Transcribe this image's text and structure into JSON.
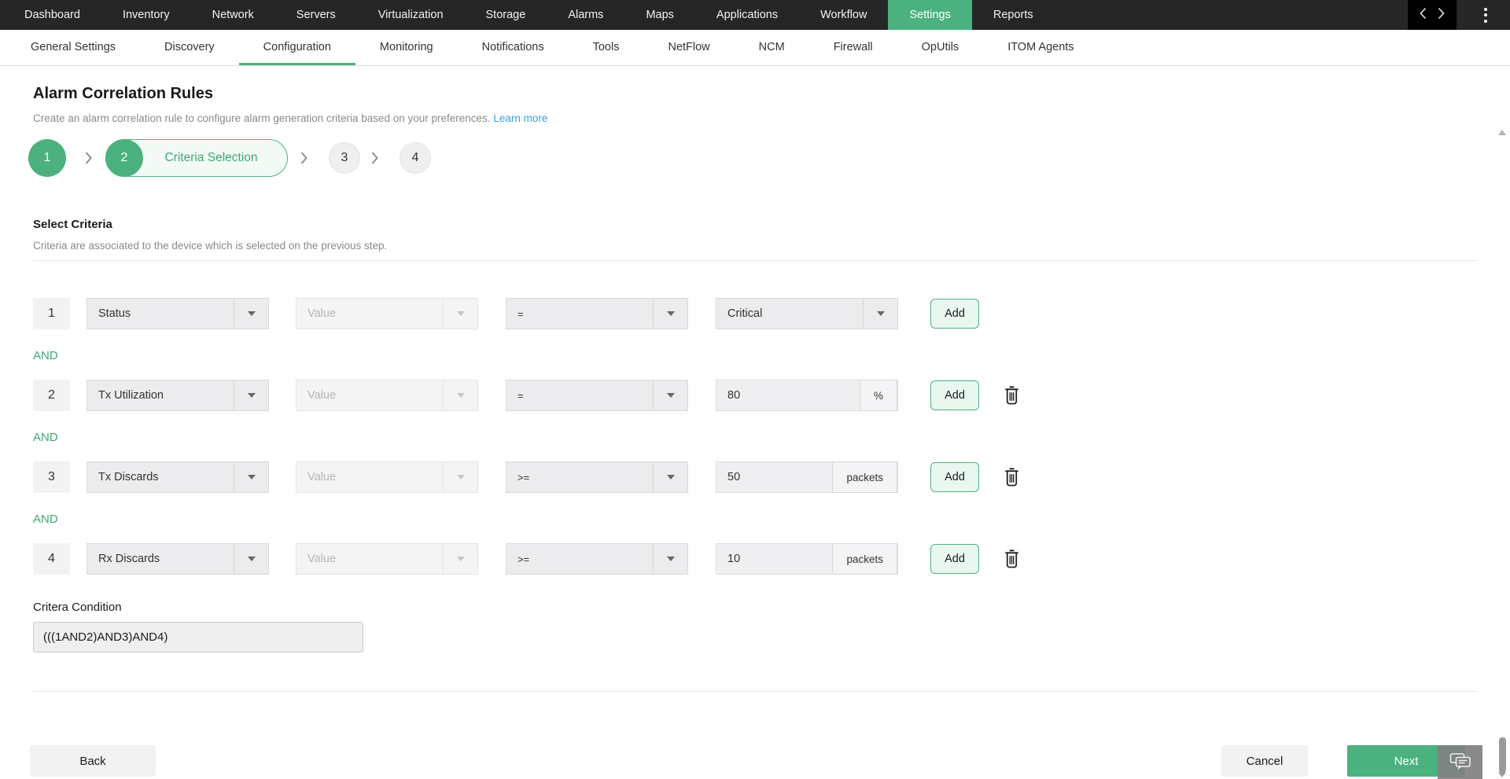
{
  "navbar": {
    "items": [
      "Dashboard",
      "Inventory",
      "Network",
      "Servers",
      "Virtualization",
      "Storage",
      "Alarms",
      "Maps",
      "Applications",
      "Workflow",
      "Settings",
      "Reports"
    ],
    "active_item": "Settings"
  },
  "tabbar": {
    "items": [
      "General Settings",
      "Discovery",
      "Configuration",
      "Monitoring",
      "Notifications",
      "Tools",
      "NetFlow",
      "NCM",
      "Firewall",
      "OpUtils",
      "ITOM Agents"
    ],
    "active_item": "Configuration"
  },
  "header": {
    "title": "Alarm Correlation Rules",
    "subtitle": "Create an alarm correlation rule to configure alarm generation criteria based on your preferences.",
    "learn_more": "Learn more"
  },
  "wizard": {
    "step1": "1",
    "step2": "2",
    "step2_label": "Criteria Selection",
    "step3": "3",
    "step4": "4",
    "active_step": "2"
  },
  "criteria": {
    "heading": "Select Criteria",
    "description": "Criteria are associated to the device which is selected on the previous step.",
    "and_label": "AND",
    "value_placeholder": "Value",
    "add_label": "Add"
  },
  "rows": [
    {
      "index": "1",
      "field": "Status",
      "operator": "=",
      "value": "Critical"
    },
    {
      "index": "2",
      "field": "Tx Utilization",
      "operator": "=",
      "value": "80",
      "unit": "%"
    },
    {
      "index": "3",
      "field": "Tx Discards",
      "operator": ">=",
      "value": "50",
      "unit": "packets"
    },
    {
      "index": "4",
      "field": "Rx Discards",
      "operator": ">=",
      "value": "10",
      "unit": "packets"
    }
  ],
  "condition": {
    "label": "Critera Condition",
    "value": "(((1AND2)AND3)AND4)"
  },
  "footer": {
    "back": "Back",
    "cancel": "Cancel",
    "next": "Next"
  },
  "colors": {
    "accent_green": "#4bb27f",
    "link_blue": "#3b9fd9",
    "nav_bg": "#262626"
  }
}
